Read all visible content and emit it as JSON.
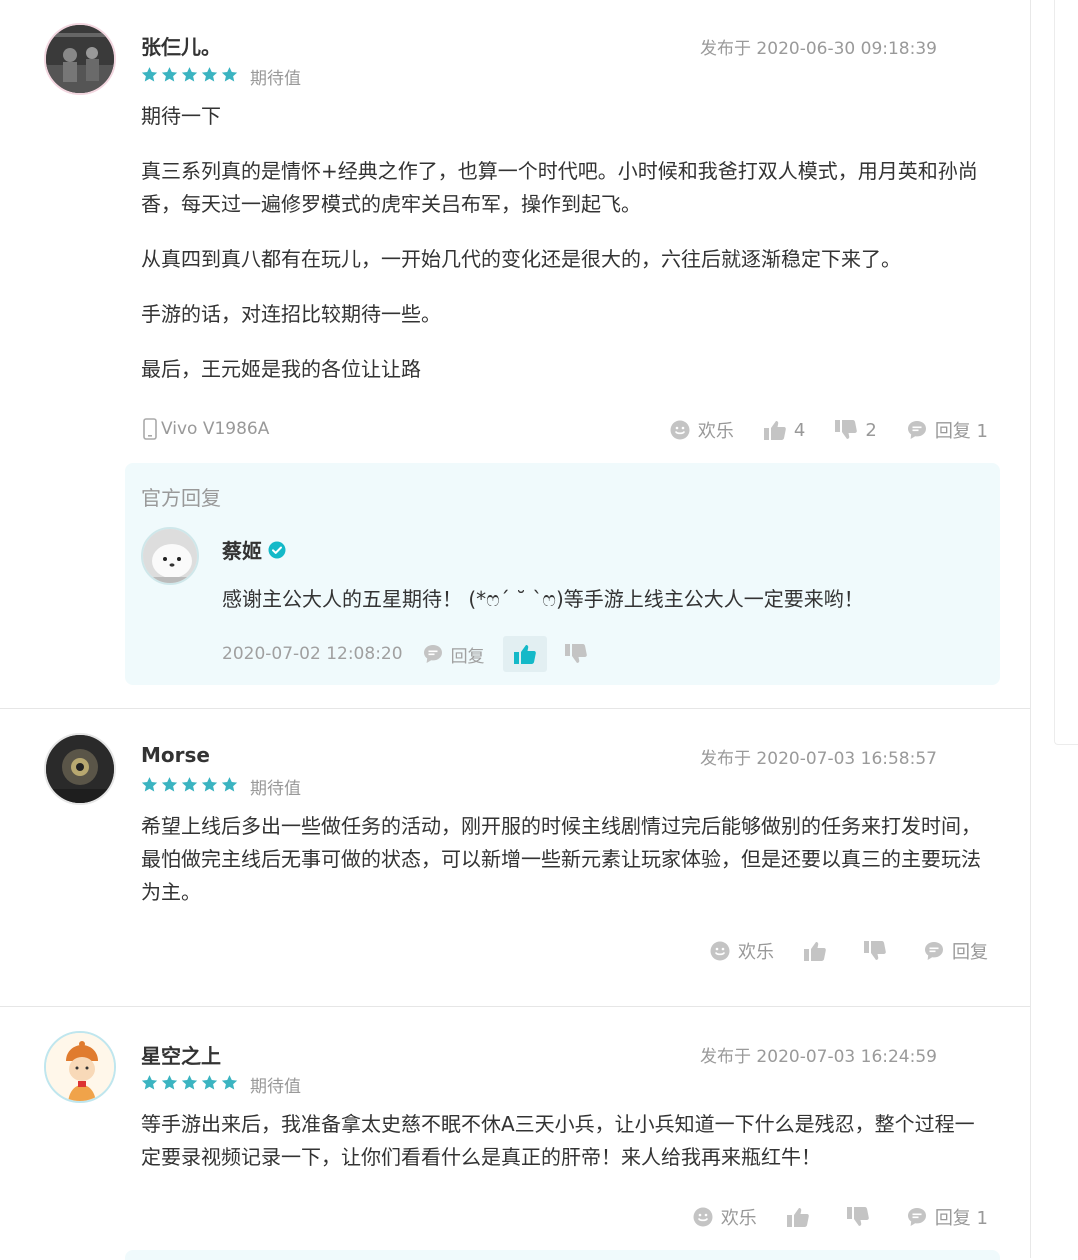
{
  "reviews": [
    {
      "name": "张仨儿。",
      "time": "发布于 2020-06-30 09:18:39",
      "star_label": "期待值",
      "rating": 5,
      "paragraphs": [
        "期待一下",
        "真三系列真的是情怀+经典之作了，也算一个时代吧。小时候和我爸打双人模式，用月英和孙尚香，每天过一遍修罗模式的虎牢关吕布军，操作到起飞。",
        "从真四到真八都有在玩儿，一开始几代的变化还是很大的，六往后就逐渐稳定下来了。",
        "手游的话，对连招比较期待一些。",
        "最后，王元姬是我的各位让让路"
      ],
      "device": "Vivo V1986A",
      "actions": {
        "fun": "欢乐",
        "likes": "4",
        "dislikes": "2",
        "reply": "回复 1"
      },
      "official": {
        "title": "官方回复",
        "name": "蔡姬",
        "text": "感谢主公大人的五星期待！ (*ෆ´ ˘ `ෆ)等手游上线主公大人一定要来哟！",
        "time": "2020-07-02 12:08:20",
        "reply": "回复"
      }
    },
    {
      "name": "Morse",
      "time": "发布于 2020-07-03 16:58:57",
      "star_label": "期待值",
      "rating": 5,
      "paragraphs": [
        "希望上线后多出一些做任务的活动，刚开服的时候主线剧情过完后能够做别的任务来打发时间，最怕做完主线后无事可做的状态，可以新增一些新元素让玩家体验，但是还要以真三的主要玩法为主。"
      ],
      "actions": {
        "fun": "欢乐",
        "reply": "回复"
      }
    },
    {
      "name": "星空之上",
      "time": "发布于 2020-07-03 16:24:59",
      "star_label": "期待值",
      "rating": 5,
      "paragraphs": [
        "等手游出来后，我准备拿太史慈不眠不休A三天小兵，让小兵知道一下什么是残忍，整个过程一定要录视频记录一下，让你们看看什么是真正的肝帝！来人给我再来瓶红牛！"
      ],
      "actions": {
        "fun": "欢乐",
        "reply": "回复 1"
      }
    }
  ],
  "colors": {
    "star": "#3bb4c1",
    "accent": "#14b9c8",
    "icon": "#bdbdbd",
    "official_bg": "#f0fafc"
  }
}
